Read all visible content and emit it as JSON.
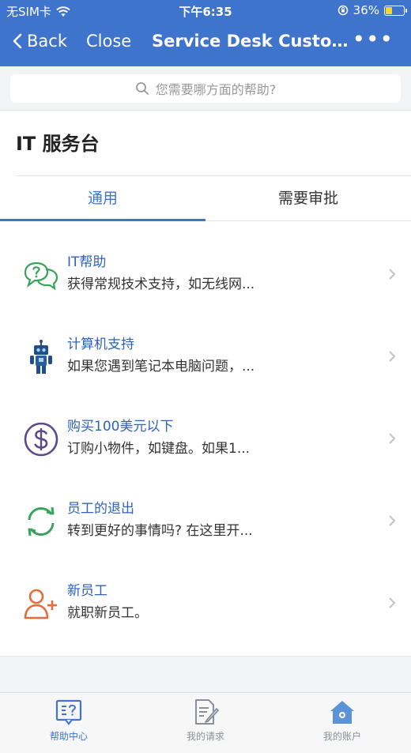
{
  "status_bar": {
    "carrier": "无SIM卡",
    "time": "下午6:35",
    "battery": "36%",
    "battery_level": 0.36
  },
  "nav": {
    "back_label": "Back",
    "close_label": "Close",
    "title": "Service Desk Customer...",
    "more_label": "•••"
  },
  "search": {
    "placeholder": "您需要哪方面的帮助?"
  },
  "section": {
    "title": "IT 服务台"
  },
  "tabs": [
    {
      "label": "通用"
    },
    {
      "label": "需要审批"
    }
  ],
  "items": [
    {
      "icon": "chat-question-icon",
      "title": "IT帮助",
      "desc": "获得常规技术支持，如无线网..."
    },
    {
      "icon": "robot-icon",
      "title": "计算机支持",
      "desc": "如果您遇到笔记本电脑问题，..."
    },
    {
      "icon": "dollar-circle-icon",
      "title": "购买100美元以下",
      "desc": "订购小物件，如键盘。如果1..."
    },
    {
      "icon": "refresh-arrows-icon",
      "title": "员工的退出",
      "desc": "转到更好的事情吗? 在这里开..."
    },
    {
      "icon": "add-person-icon",
      "title": "新员工",
      "desc": "就职新员工。"
    }
  ],
  "tabbar": [
    {
      "icon": "help-center-icon",
      "label": "帮助中心"
    },
    {
      "icon": "requests-icon",
      "label": "我的请求"
    },
    {
      "icon": "account-home-icon",
      "label": "我的账户"
    }
  ],
  "colors": {
    "accent": "#3f74cc",
    "green": "#3aa35a",
    "purple": "#5b4a8b",
    "orange": "#e36e3a"
  }
}
